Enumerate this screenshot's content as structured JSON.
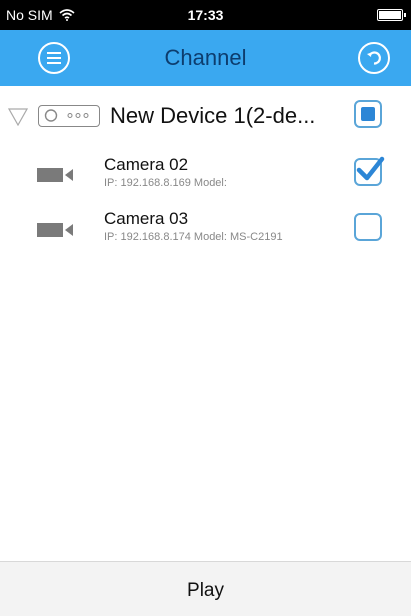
{
  "status_bar": {
    "carrier": "No SIM",
    "time": "17:33"
  },
  "nav": {
    "title": "Channel",
    "left_icon": "menu-icon",
    "right_icon": "refresh-icon"
  },
  "device": {
    "name": "New Device 1(2-de...",
    "checked": "partial"
  },
  "cameras": [
    {
      "name": "Camera 02",
      "info": "IP: 192.168.8.169 Model:",
      "checked": true
    },
    {
      "name": "Camera 03",
      "info": "IP: 192.168.8.174 Model: MS-C2191",
      "checked": false
    }
  ],
  "footer": {
    "play_label": "Play"
  },
  "colors": {
    "nav_bg": "#3aa8f0",
    "title": "#0d3d6e",
    "check": "#2c86d6"
  }
}
